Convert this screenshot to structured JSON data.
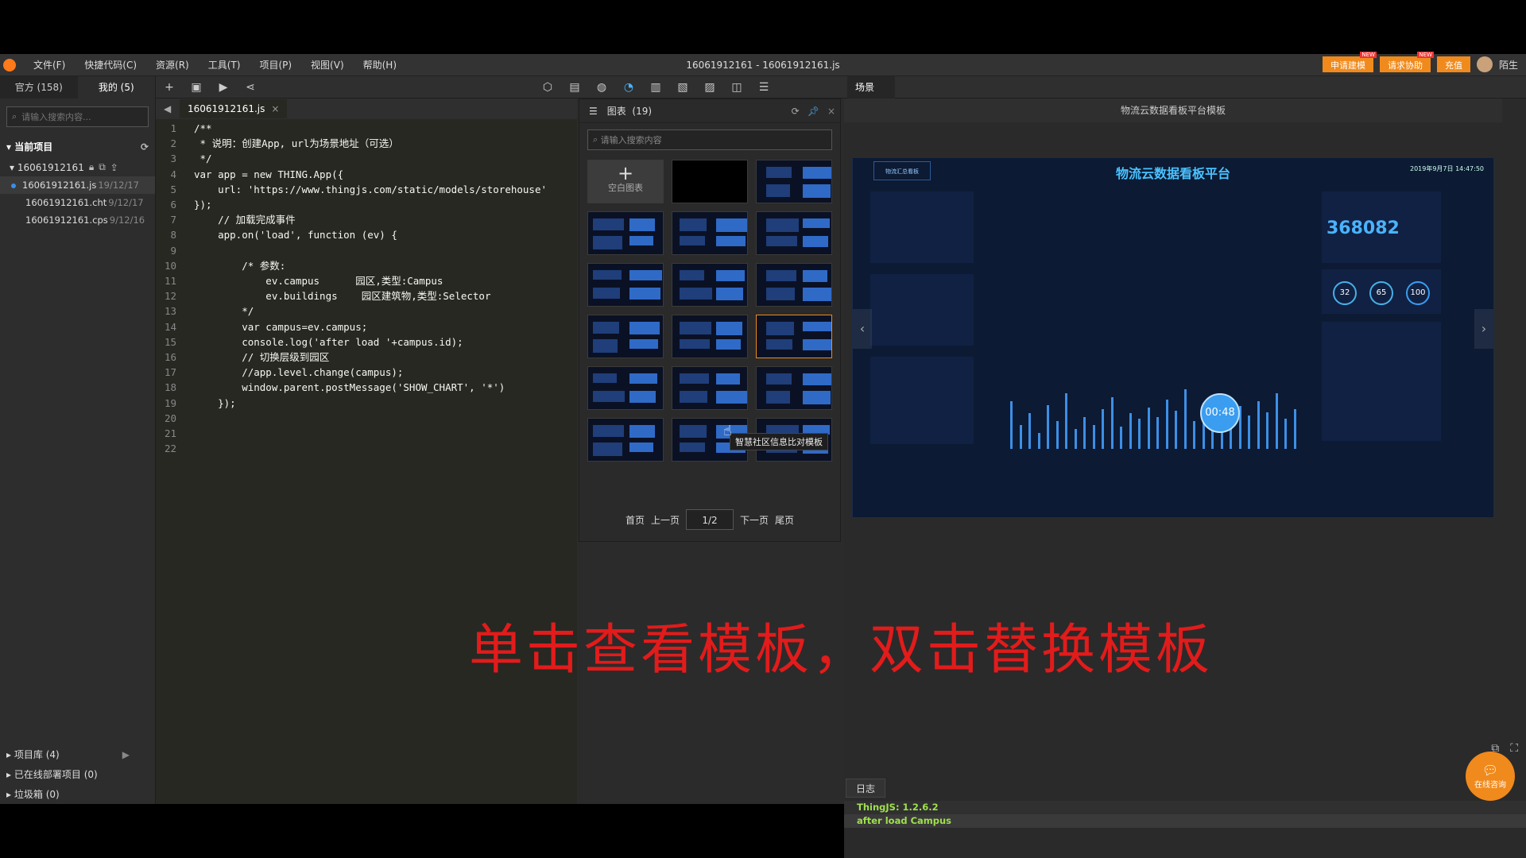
{
  "menubar": {
    "items": [
      "文件(F)",
      "快捷代码(C)",
      "资源(R)",
      "工具(T)",
      "项目(P)",
      "视图(V)",
      "帮助(H)"
    ],
    "title": "16061912161 - 16061912161.js",
    "right_buttons": [
      "申请建模",
      "请求协助",
      "充值"
    ],
    "user": "陌生"
  },
  "sidebar": {
    "tabs": [
      "官方 (158)",
      "我的 (5)"
    ],
    "search_placeholder": "请输入搜索内容...",
    "current_project": "当前项目",
    "project_name": "16061912161",
    "files": [
      {
        "name": "16061912161.js",
        "date": "19/12/17"
      },
      {
        "name": "16061912161.cht",
        "date": "9/12/17"
      },
      {
        "name": "16061912161.cps",
        "date": "9/12/16"
      }
    ],
    "bottom": [
      {
        "label": "项目库",
        "count": "(4)"
      },
      {
        "label": "已在线部署项目",
        "count": "(0)"
      },
      {
        "label": "垃圾箱",
        "count": "(0)"
      }
    ]
  },
  "toolbar": {
    "scene_tab": "场景"
  },
  "editor": {
    "tab_name": "16061912161.js",
    "lines": [
      {
        "n": "1",
        "t": "/**"
      },
      {
        "n": "2",
        "t": " * 说明：创建App, url为场景地址（可选）"
      },
      {
        "n": "3",
        "t": " */"
      },
      {
        "n": "4",
        "t": "var app = new THING.App({"
      },
      {
        "n": "5",
        "t": "    url: 'https://www.thingjs.com/static/models/storehouse'"
      },
      {
        "n": "6",
        "t": "});"
      },
      {
        "n": "7",
        "t": "    // 加载完成事件"
      },
      {
        "n": "8",
        "t": "    app.on('load', function (ev) {"
      },
      {
        "n": "9",
        "t": ""
      },
      {
        "n": "10",
        "t": "        /* 参数:"
      },
      {
        "n": "11",
        "t": "            ev.campus      园区,类型:Campus"
      },
      {
        "n": "12",
        "t": "            ev.buildings    园区建筑物,类型:Selector"
      },
      {
        "n": "13",
        "t": "        */"
      },
      {
        "n": "14",
        "t": "        var campus=ev.campus;"
      },
      {
        "n": "15",
        "t": "        console.log('after load '+campus.id);"
      },
      {
        "n": "16",
        "t": "        // 切换层级到园区"
      },
      {
        "n": "17",
        "t": "        //app.level.change(campus);"
      },
      {
        "n": "18",
        "t": "        window.parent.postMessage('SHOW_CHART', '*')"
      },
      {
        "n": "19",
        "t": "    });"
      },
      {
        "n": "20",
        "t": ""
      },
      {
        "n": "21",
        "t": ""
      },
      {
        "n": "22",
        "t": ""
      }
    ]
  },
  "gallery": {
    "title": "图表",
    "count": "(19)",
    "search_placeholder": "请输入搜索内容",
    "blank_label": "空白图表",
    "tooltip": "智慧社区信息比对模板",
    "pager": {
      "first": "首页",
      "prev": "上一页",
      "page": "1/2",
      "next": "下一页",
      "last": "尾页"
    }
  },
  "preview": {
    "title": "物流云数据看板平台模板",
    "dash_title": "物流云数据看板平台",
    "dash_date": "2019年9月7日  14:47:50",
    "dash_btn": "物流汇总看板",
    "big_value": "368082",
    "rings": [
      "32",
      "65",
      "100"
    ],
    "timer": "00:48"
  },
  "overlay_caption": "单击查看模板，双击替换模板",
  "log": {
    "tab": "日志",
    "lines": [
      "ThingJS: 1.2.6.2",
      "after load Campus"
    ]
  },
  "chat": {
    "label": "在线咨询"
  }
}
